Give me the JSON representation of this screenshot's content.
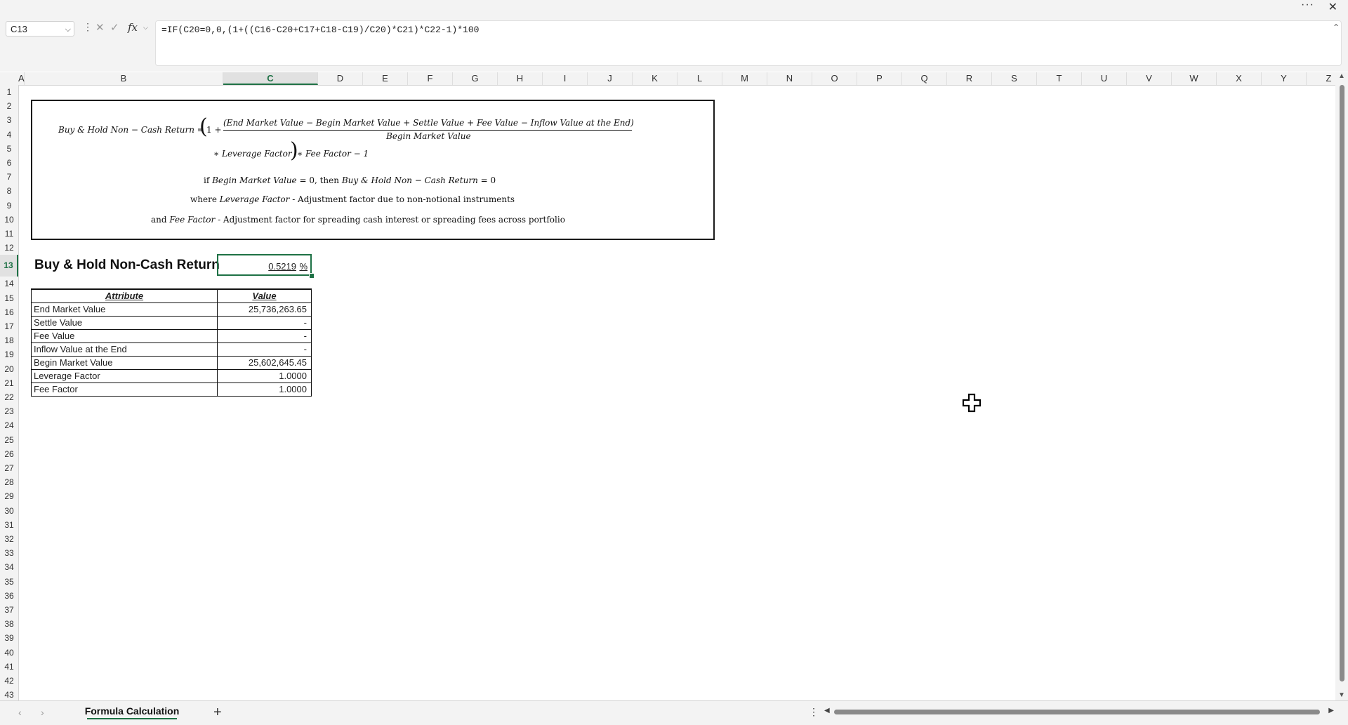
{
  "window": {
    "more_label": "···",
    "close_label": "✕"
  },
  "formula_bar": {
    "name_box": "C13",
    "formula": "=IF(C20=0,0,(1+((C16-C20+C17+C18-C19)/C20)*C21)*C22-1)*100",
    "fx_label": "fx"
  },
  "columns": [
    "A",
    "B",
    "C",
    "D",
    "E",
    "F",
    "G",
    "H",
    "I",
    "J",
    "K",
    "L",
    "M",
    "N",
    "O",
    "P",
    "Q",
    "R",
    "S",
    "T",
    "U",
    "V",
    "W",
    "X",
    "Y",
    "Z"
  ],
  "selected_column": "C",
  "rows": [
    "1",
    "2",
    "3",
    "4",
    "5",
    "6",
    "7",
    "8",
    "9",
    "10",
    "11",
    "12",
    "13",
    "14",
    "15",
    "16",
    "17",
    "18",
    "19",
    "20",
    "21",
    "22",
    "23",
    "24",
    "25",
    "26",
    "27",
    "28",
    "29",
    "30",
    "31",
    "32",
    "33",
    "34",
    "35",
    "36",
    "37",
    "38",
    "39",
    "40",
    "41",
    "42",
    "43"
  ],
  "selected_row": "13",
  "formula_image": {
    "lhs": "Buy & Hold Non − Cash Return = ",
    "one_plus": "1 + ",
    "numerator": "(End Market Value − Begin Market Value + Settle Value + Fee Value − Inflow Value at the End)",
    "denominator": "Begin Market Value",
    "line2": "∗ Leverage Factor",
    "line2_tail": " ∗ Fee Factor − 1",
    "cond_pre": "if ",
    "cond_var": "Begin Market Value",
    "cond_mid": " = 0, then ",
    "cond_var2": "Buy & Hold Non − Cash Return",
    "cond_post": " = 0",
    "where_pre": "where ",
    "where_var": "Leverage Factor",
    "where_post": " - Adjustment factor due to non-notional instruments",
    "and_pre": "and ",
    "and_var": "Fee Factor",
    "and_post": " - Adjustment factor for spreading cash interest or spreading fees across portfolio"
  },
  "result": {
    "label": "Buy & Hold Non-Cash Return",
    "value": "0.5219",
    "unit": "%"
  },
  "table": {
    "headers": [
      "Attribute",
      "Value"
    ],
    "rows": [
      {
        "attribute": "End Market Value",
        "value": "25,736,263.65"
      },
      {
        "attribute": "Settle Value",
        "value": "-"
      },
      {
        "attribute": "Fee Value",
        "value": "-"
      },
      {
        "attribute": "Inflow Value at the End",
        "value": "-"
      },
      {
        "attribute": "Begin Market Value",
        "value": "25,602,645.45"
      },
      {
        "attribute": "Leverage Factor",
        "value": "1.0000"
      },
      {
        "attribute": "Fee Factor",
        "value": "1.0000"
      }
    ]
  },
  "sheets": [
    {
      "name": "Formula Calculation",
      "active": true
    }
  ],
  "colors": {
    "accent": "#1e7145"
  }
}
